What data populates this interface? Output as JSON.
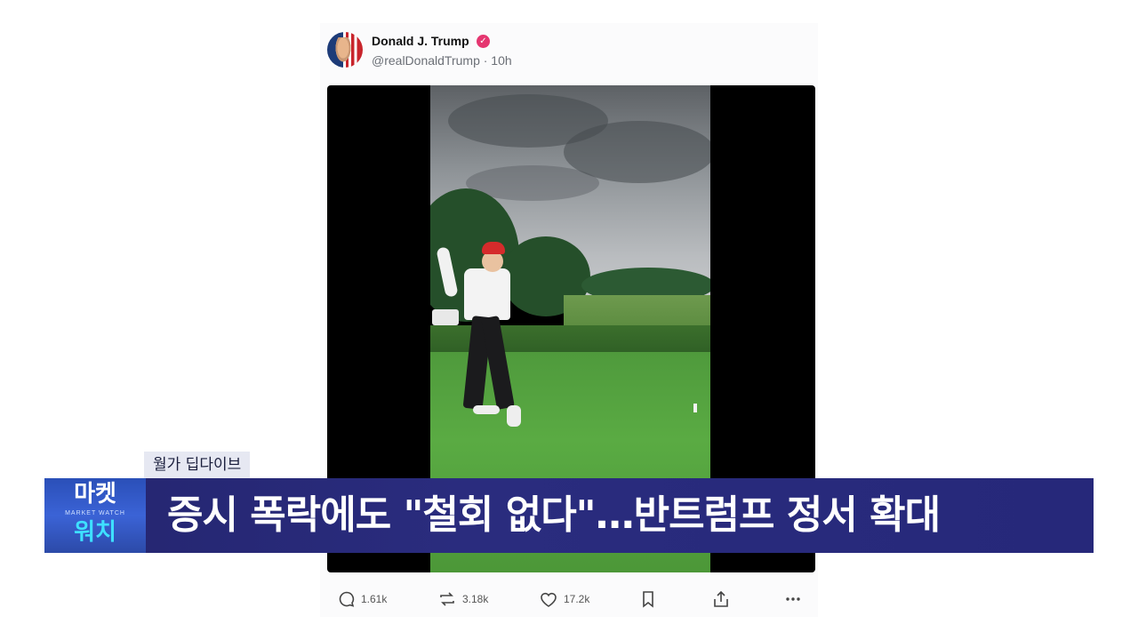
{
  "post": {
    "author_name": "Donald J. Trump",
    "handle_time": "@realDonaldTrump · 10h",
    "verified_icon": "verified-badge-icon"
  },
  "actions": {
    "replies": "1.61k",
    "reposts": "3.18k",
    "likes": "17.2k"
  },
  "overlay": {
    "tag": "월가 딥다이브",
    "logo_top": "마켓",
    "logo_middle": "MARKET WATCH",
    "logo_bottom": "워치",
    "headline": "증시 폭락에도 \"철회 없다\"…반트럼프 정서 확대"
  },
  "colors": {
    "headline_bar": "#26287a",
    "logo_bg": "#3b63d6",
    "logo_accent": "#3ee0ff",
    "verified": "#e53670"
  }
}
